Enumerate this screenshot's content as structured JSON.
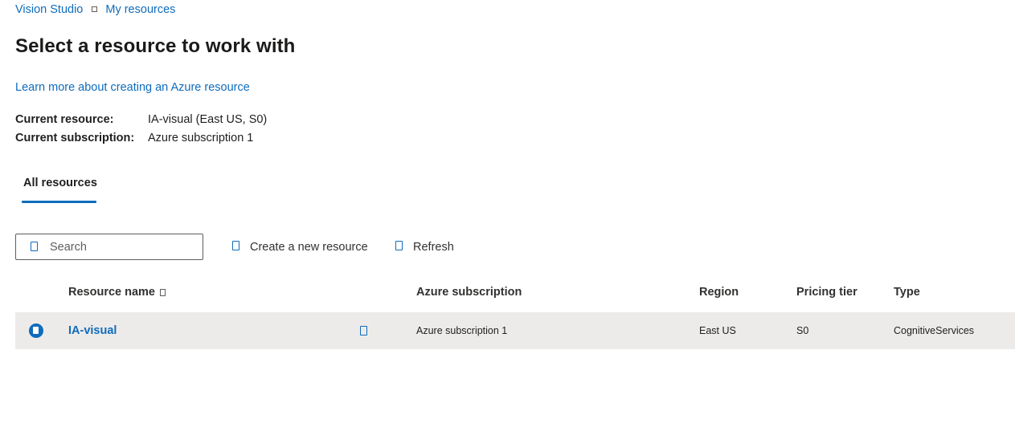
{
  "breadcrumb": {
    "items": [
      "Vision Studio",
      "My resources"
    ]
  },
  "page_title": "Select a resource to work with",
  "learn_link": "Learn more about creating an Azure resource",
  "current": {
    "resource_label": "Current resource:",
    "resource_value": "IA-visual (East US, S0)",
    "subscription_label": "Current subscription:",
    "subscription_value": "Azure subscription 1"
  },
  "tabs": [
    {
      "label": "All resources",
      "selected": true
    }
  ],
  "toolbar": {
    "search_placeholder": "Search",
    "create_label": "Create a new resource",
    "refresh_label": "Refresh"
  },
  "table": {
    "columns": [
      "Resource name",
      "Azure subscription",
      "Region",
      "Pricing tier",
      "Type"
    ],
    "rows": [
      {
        "name": "IA-visual",
        "subscription": "Azure subscription 1",
        "region": "East US",
        "tier": "S0",
        "type": "CognitiveServices",
        "selected": true
      }
    ]
  },
  "icons": {
    "breadcrumb_separator": "chevron-right-icon",
    "search": "search-icon",
    "create": "add-icon",
    "refresh": "refresh-icon",
    "sort": "sort-icon",
    "row_select": "radio-selected-icon",
    "copy": "copy-icon"
  },
  "colors": {
    "accent": "#0f6cbd",
    "row_selected_bg": "#edebe9",
    "text": "#201f1e"
  }
}
